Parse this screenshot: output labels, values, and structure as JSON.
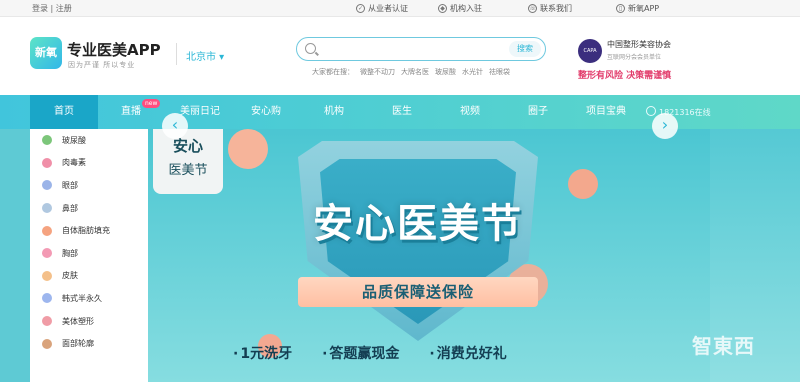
{
  "topbar": {
    "login": "登录",
    "sep": "|",
    "register": "注册",
    "links": [
      {
        "label": "从业者认证",
        "icon": "check-shield-icon"
      },
      {
        "label": "机构入驻",
        "icon": "shield-icon"
      },
      {
        "label": "联系我们",
        "icon": "phone-icon"
      },
      {
        "label": "新氧APP",
        "icon": "mobile-icon"
      }
    ]
  },
  "header": {
    "logo_text": "新氧",
    "app_title": "专业医美APP",
    "slogan": "因为严谨  所以专业",
    "city": "北京市 ▾",
    "search": {
      "placeholder": "",
      "button": "搜索"
    },
    "hot_label": "大家都在搜：",
    "hot_terms": [
      "微整不动刀",
      "大牌名医",
      "玻尿酸",
      "水光针",
      "祛眼袋"
    ],
    "association": {
      "badge": "CAPA",
      "name": "中国整形美容协会",
      "sub": "互联网分会会员单位",
      "warning": "整形有风险  决策需谨慎"
    }
  },
  "nav": {
    "items": [
      "首页",
      "直播",
      "美丽日记",
      "安心购",
      "机构",
      "医生",
      "视频",
      "圈子",
      "项目宝典"
    ],
    "new_badge": "new",
    "online": "1821316在线"
  },
  "sidebar": {
    "items": [
      {
        "label": "玻尿酸",
        "color": "#7cc67a"
      },
      {
        "label": "肉毒素",
        "color": "#f08fa8"
      },
      {
        "label": "眼部",
        "color": "#9bb4e8"
      },
      {
        "label": "鼻部",
        "color": "#b0c8e0"
      },
      {
        "label": "自体脂肪填充",
        "color": "#f5a380"
      },
      {
        "label": "胸部",
        "color": "#f39ab4"
      },
      {
        "label": "皮肤",
        "color": "#f4c08a"
      },
      {
        "label": "韩式半永久",
        "color": "#9db6ee"
      },
      {
        "label": "美体塑形",
        "color": "#f09ca6"
      },
      {
        "label": "面部轮廓",
        "color": "#d9a37c"
      }
    ]
  },
  "banner": {
    "tag_line1": "安心",
    "tag_line2": "医美节",
    "title": "安心医美节",
    "ribbon": "品质保障送保险",
    "bottom": [
      "1元洗牙",
      "答题赢现金",
      "消费兑好礼"
    ]
  },
  "watermark": "智東西",
  "colors": {
    "accent": "#2bb7d6",
    "nav_start": "#41c5dc",
    "nav_end": "#5fd8c8",
    "warning": "#e23c6b"
  }
}
